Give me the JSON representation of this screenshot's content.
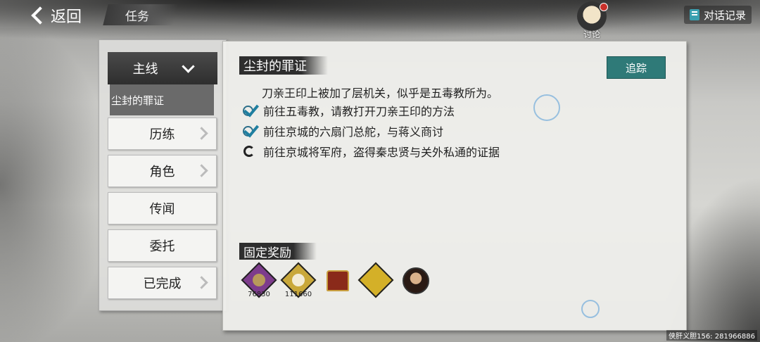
{
  "header": {
    "back_label": "返回",
    "title": "任务",
    "discuss_label": "讨论",
    "dialog_record_label": "对话记录"
  },
  "sidebar": {
    "main_line_label": "主线",
    "sub_quest_label": "尘封的罪证",
    "categories": [
      {
        "label": "历练",
        "arrow": true
      },
      {
        "label": "角色",
        "arrow": true
      },
      {
        "label": "传闻",
        "arrow": false
      },
      {
        "label": "委托",
        "arrow": false
      },
      {
        "label": "已完成",
        "arrow": true
      }
    ]
  },
  "quest": {
    "title": "尘封的罪证",
    "track_label": "追踪",
    "description": "刀亲王印上被加了层机关，似乎是五毒教所为。",
    "steps": [
      {
        "text": "前往五毒教，请教打开刀亲王印的方法",
        "status": "done"
      },
      {
        "text": "前往京城的六扇门总舵，与蒋义商讨",
        "status": "done"
      },
      {
        "text": "前往京城将军府，盗得秦忠贤与关外私通的证据",
        "status": "in-progress"
      }
    ],
    "reward_title": "固定奖励",
    "rewards": [
      {
        "icon": "purple-coin-icon",
        "count": "76830",
        "color": "#7d3c8c"
      },
      {
        "icon": "gold-coin-icon",
        "count": "111660",
        "color": "#c9a83a"
      },
      {
        "icon": "treasure-chest-icon",
        "count": "",
        "color": "#8a2a1a"
      },
      {
        "icon": "scroll-icon",
        "count": "",
        "color": "#d4b028"
      },
      {
        "icon": "character-portrait-icon",
        "count": "",
        "color": "#2a1a14"
      }
    ]
  },
  "footer_text": "侠肝义胆156: 281966886"
}
